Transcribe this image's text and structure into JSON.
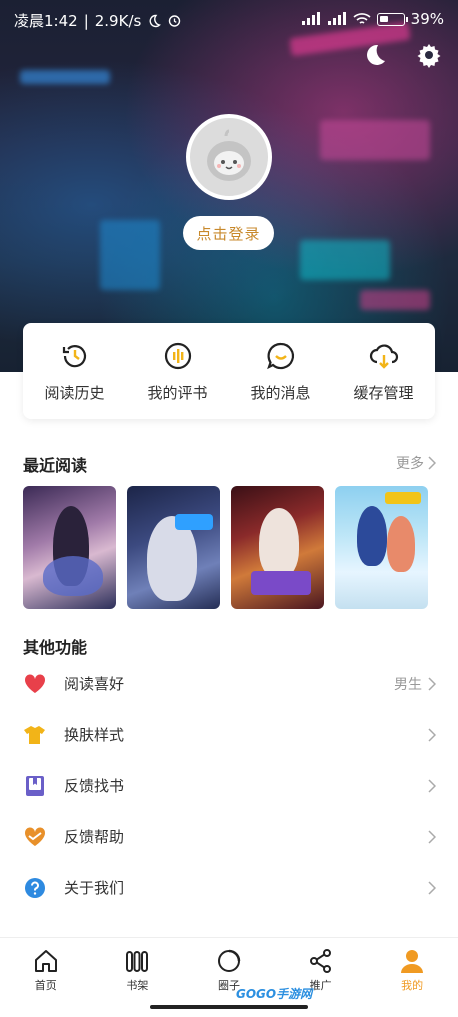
{
  "status_bar": {
    "time": "凌晨1:42",
    "speed": "2.9K/s",
    "battery": "39%"
  },
  "profile": {
    "login_label": "点击登录"
  },
  "quick_actions": [
    {
      "label": "阅读历史",
      "icon": "history-icon"
    },
    {
      "label": "我的评书",
      "icon": "review-icon"
    },
    {
      "label": "我的消息",
      "icon": "message-icon"
    },
    {
      "label": "缓存管理",
      "icon": "download-icon"
    }
  ],
  "recent": {
    "title": "最近阅读",
    "more_label": "更多"
  },
  "other": {
    "title": "其他功能",
    "items": [
      {
        "label": "阅读喜好",
        "value": "男生",
        "icon": "heart-icon",
        "color": "#e8404a"
      },
      {
        "label": "换肤样式",
        "value": "",
        "icon": "shirt-icon",
        "color": "#f2b418"
      },
      {
        "label": "反馈找书",
        "value": "",
        "icon": "book-icon",
        "color": "#6a5fc8"
      },
      {
        "label": "反馈帮助",
        "value": "",
        "icon": "help-heart-icon",
        "color": "#e8902a"
      },
      {
        "label": "关于我们",
        "value": "",
        "icon": "question-icon",
        "color": "#2e8ae0"
      }
    ]
  },
  "nav": {
    "items": [
      {
        "label": "首页",
        "icon": "home-icon"
      },
      {
        "label": "书架",
        "icon": "bookshelf-icon"
      },
      {
        "label": "圈子",
        "icon": "circle-icon"
      },
      {
        "label": "推广",
        "icon": "share-icon"
      },
      {
        "label": "我的",
        "icon": "user-icon"
      }
    ],
    "active_index": 4
  },
  "watermark": "GOGO手游网",
  "colors": {
    "accent": "#f09a22",
    "login_text": "#c8892c"
  }
}
